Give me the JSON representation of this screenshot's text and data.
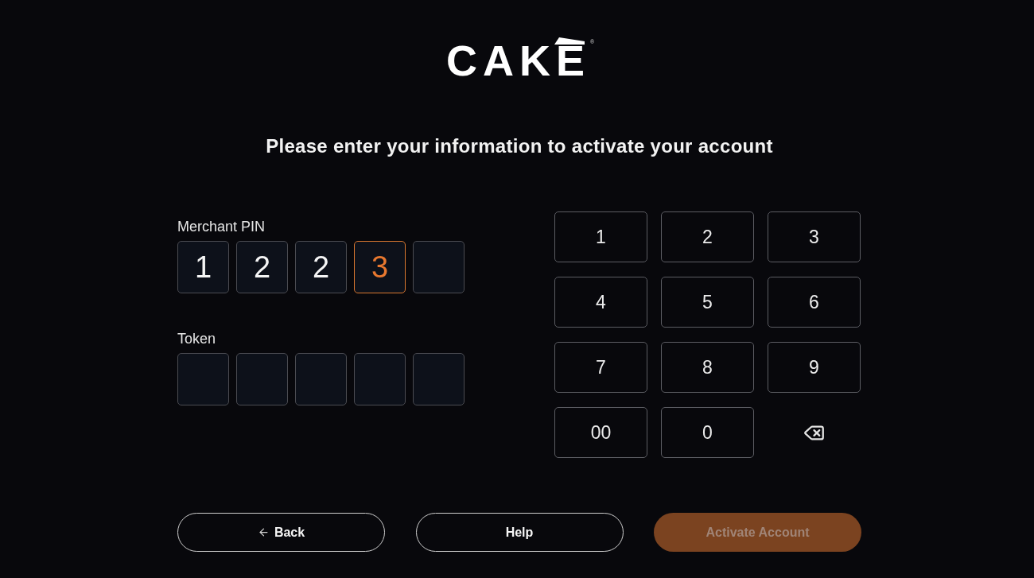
{
  "logo": {
    "text": "CAKE",
    "mark": "®"
  },
  "heading": "Please enter your information to activate your account",
  "fields": [
    {
      "label": "Merchant PIN",
      "cells": [
        {
          "value": "1",
          "selected": false
        },
        {
          "value": "2",
          "selected": false
        },
        {
          "value": "2",
          "selected": false
        },
        {
          "value": "3",
          "selected": true
        },
        {
          "selected": false
        }
      ]
    },
    {
      "label": "Token",
      "cells": [
        {
          "selected": false
        },
        {
          "selected": false
        },
        {
          "selected": false
        },
        {
          "selected": false
        },
        {
          "selected": false
        }
      ]
    }
  ],
  "keypad": [
    {
      "kind": "digit",
      "label": "1"
    },
    {
      "kind": "digit",
      "label": "2"
    },
    {
      "kind": "digit",
      "label": "3"
    },
    {
      "kind": "digit",
      "label": "4"
    },
    {
      "kind": "digit",
      "label": "5"
    },
    {
      "kind": "digit",
      "label": "6"
    },
    {
      "kind": "digit",
      "label": "7"
    },
    {
      "kind": "digit",
      "label": "8"
    },
    {
      "kind": "digit",
      "label": "9"
    },
    {
      "kind": "digit",
      "label": "00"
    },
    {
      "kind": "digit",
      "label": "0"
    },
    {
      "kind": "backspace"
    }
  ],
  "buttons": [
    {
      "kind": "back",
      "label": "Back",
      "disabled": false
    },
    {
      "kind": "help",
      "label": "Help",
      "disabled": false
    },
    {
      "kind": "primary",
      "label": "Activate Account",
      "disabled": true
    }
  ]
}
